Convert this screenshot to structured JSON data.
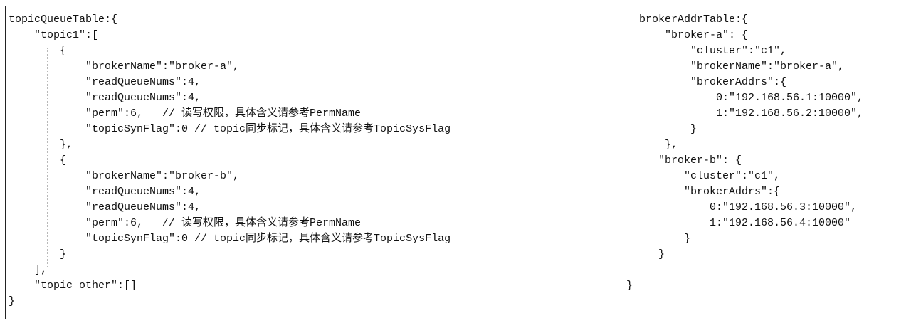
{
  "left_code": {
    "lines": [
      "topicQueueTable:{",
      "    \"topic1\":[",
      "        {",
      "            \"brokerName\":\"broker-a\",",
      "            \"readQueueNums\":4,",
      "            \"readQueueNums\":4,",
      "            \"perm\":6,   // 读写权限，具体含义请参考PermName",
      "            \"topicSynFlag\":0 // topic同步标记，具体含义请参考TopicSysFlag",
      "        },",
      "        {",
      "            \"brokerName\":\"broker-b\",",
      "            \"readQueueNums\":4,",
      "            \"readQueueNums\":4,",
      "            \"perm\":6,   // 读写权限，具体含义请参考PermName",
      "            \"topicSynFlag\":0 // topic同步标记，具体含义请参考TopicSysFlag",
      "        }",
      "    ],",
      "    \"topic other\":[]",
      "}"
    ]
  },
  "right_code": {
    "lines": [
      "  brokerAddrTable:{",
      "      \"broker-a\": {",
      "          \"cluster\":\"c1\",",
      "          \"brokerName\":\"broker-a\",",
      "          \"brokerAddrs\":{",
      "              0:\"192.168.56.1:10000\",",
      "              1:\"192.168.56.2:10000\",",
      "          }",
      "      },",
      "     \"broker-b\": {",
      "         \"cluster\":\"c1\",",
      "         \"brokerAddrs\":{",
      "             0:\"192.168.56.3:10000\",",
      "             1:\"192.168.56.4:10000\"",
      "         }",
      "     }",
      "",
      "}"
    ]
  }
}
